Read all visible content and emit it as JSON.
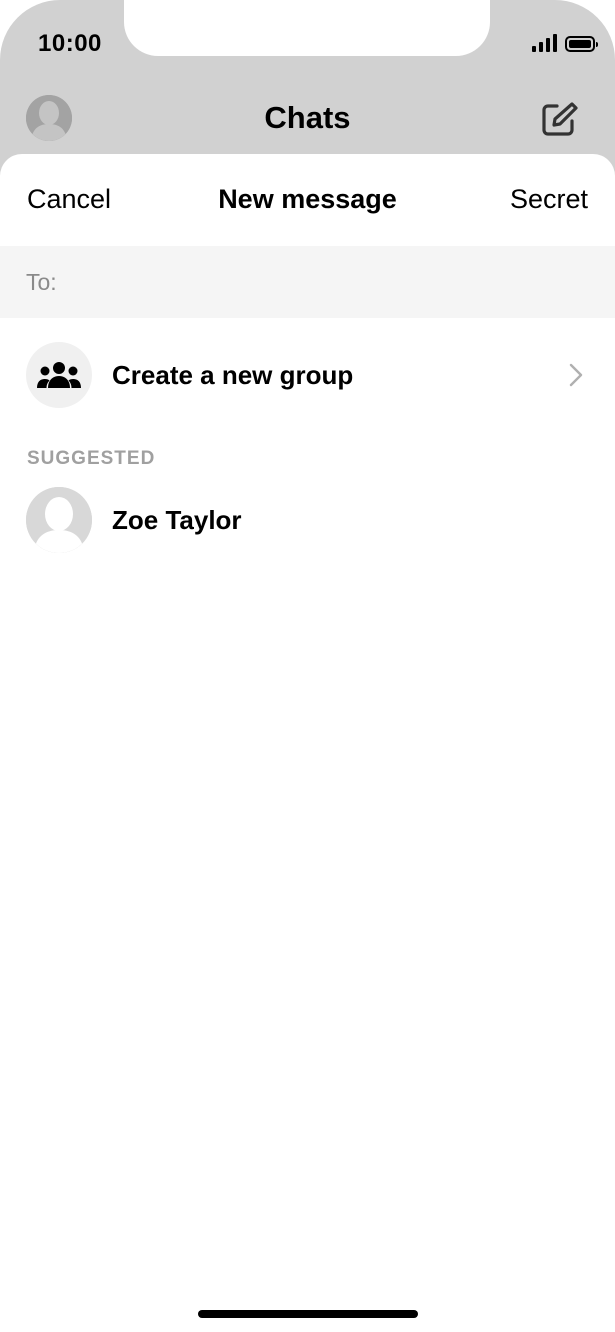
{
  "status_bar": {
    "time": "10:00",
    "signal_icon": "signal-bars-icon",
    "battery_icon": "battery-icon"
  },
  "background_header": {
    "title": "Chats",
    "avatar_icon": "profile-avatar-icon",
    "compose_icon": "compose-icon"
  },
  "sheet": {
    "cancel_label": "Cancel",
    "title": "New message",
    "secret_label": "Secret",
    "to_label": "To:",
    "to_value": "",
    "create_group": {
      "label": "Create a new group",
      "icon": "group-people-icon",
      "chevron_icon": "chevron-right-icon"
    },
    "suggested_header": "SUGGESTED",
    "suggested": [
      {
        "name": "Zoe Taylor",
        "avatar_icon": "default-avatar-icon"
      }
    ]
  },
  "colors": {
    "backdrop": "#d1d1d1",
    "to_row_bg": "#f5f5f5",
    "muted_text": "#8a8a8a",
    "section_header": "#a0a0a0",
    "avatar_placeholder": "#d8d8d8"
  }
}
